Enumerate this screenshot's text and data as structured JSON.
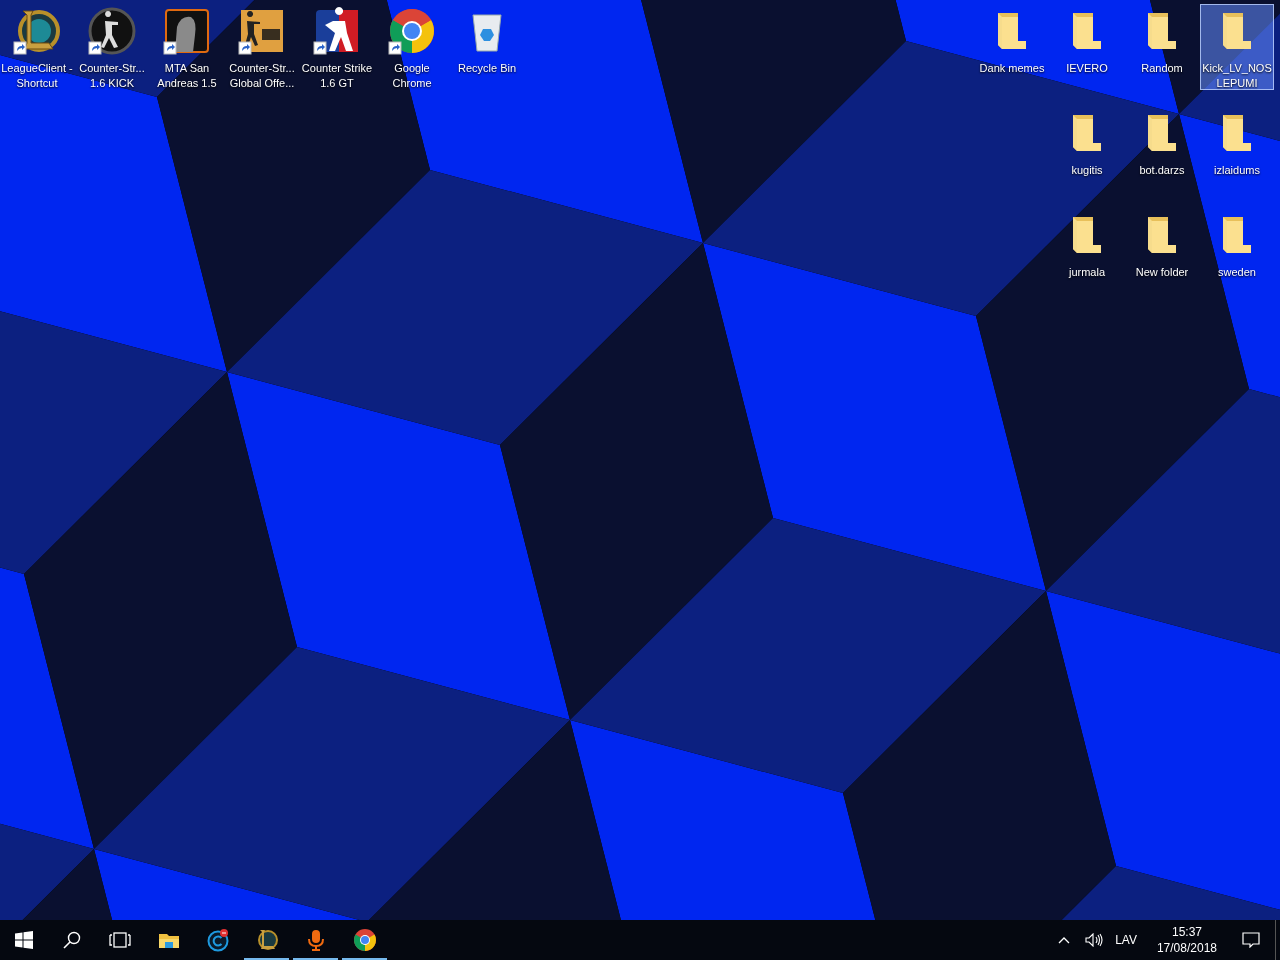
{
  "desktop": {
    "left_icons": [
      {
        "label": "LeagueClient - Shortcut",
        "kind": "league",
        "shortcut": true,
        "selected": false
      },
      {
        "label": "Counter-Str... 1.6 KICK",
        "kind": "cs",
        "shortcut": true,
        "selected": false
      },
      {
        "label": "MTA San Andreas 1.5",
        "kind": "mta",
        "shortcut": true,
        "selected": false
      },
      {
        "label": "Counter-Str... Global Offe...",
        "kind": "csgo",
        "shortcut": true,
        "selected": false
      },
      {
        "label": "Counter Strike 1.6 GT",
        "kind": "cs-gt",
        "shortcut": true,
        "selected": false
      },
      {
        "label": "Google Chrome",
        "kind": "chrome",
        "shortcut": true,
        "selected": false
      },
      {
        "label": "Recycle Bin",
        "kind": "recycle-bin",
        "shortcut": false,
        "selected": false
      }
    ],
    "right_columns": [
      [
        {
          "label": "Dank memes",
          "kind": "folder",
          "shortcut": false,
          "selected": false
        }
      ],
      [
        {
          "label": "IEVERO",
          "kind": "folder",
          "shortcut": false,
          "selected": false
        },
        {
          "label": "kugitis",
          "kind": "folder",
          "shortcut": false,
          "selected": false
        },
        {
          "label": "jurmala",
          "kind": "folder",
          "shortcut": false,
          "selected": false
        }
      ],
      [
        {
          "label": "Random",
          "kind": "folder",
          "shortcut": false,
          "selected": false
        },
        {
          "label": "bot.darzs",
          "kind": "folder",
          "shortcut": false,
          "selected": false
        },
        {
          "label": "New folder",
          "kind": "folder",
          "shortcut": false,
          "selected": false
        }
      ],
      [
        {
          "label": "Kick_LV_NOS LEPUMI",
          "kind": "folder",
          "shortcut": false,
          "selected": true
        },
        {
          "label": "izlaidums",
          "kind": "folder",
          "shortcut": false,
          "selected": false
        },
        {
          "label": "sweden",
          "kind": "folder",
          "shortcut": false,
          "selected": false
        }
      ]
    ]
  },
  "taskbar": {
    "apps": [
      {
        "kind": "explorer",
        "running": false
      },
      {
        "kind": "cleaner",
        "running": false
      },
      {
        "kind": "league",
        "running": true
      },
      {
        "kind": "mic",
        "running": true
      },
      {
        "kind": "chrome",
        "running": true
      }
    ],
    "language": "LAV",
    "time": "15:37",
    "date": "17/08/2018"
  }
}
